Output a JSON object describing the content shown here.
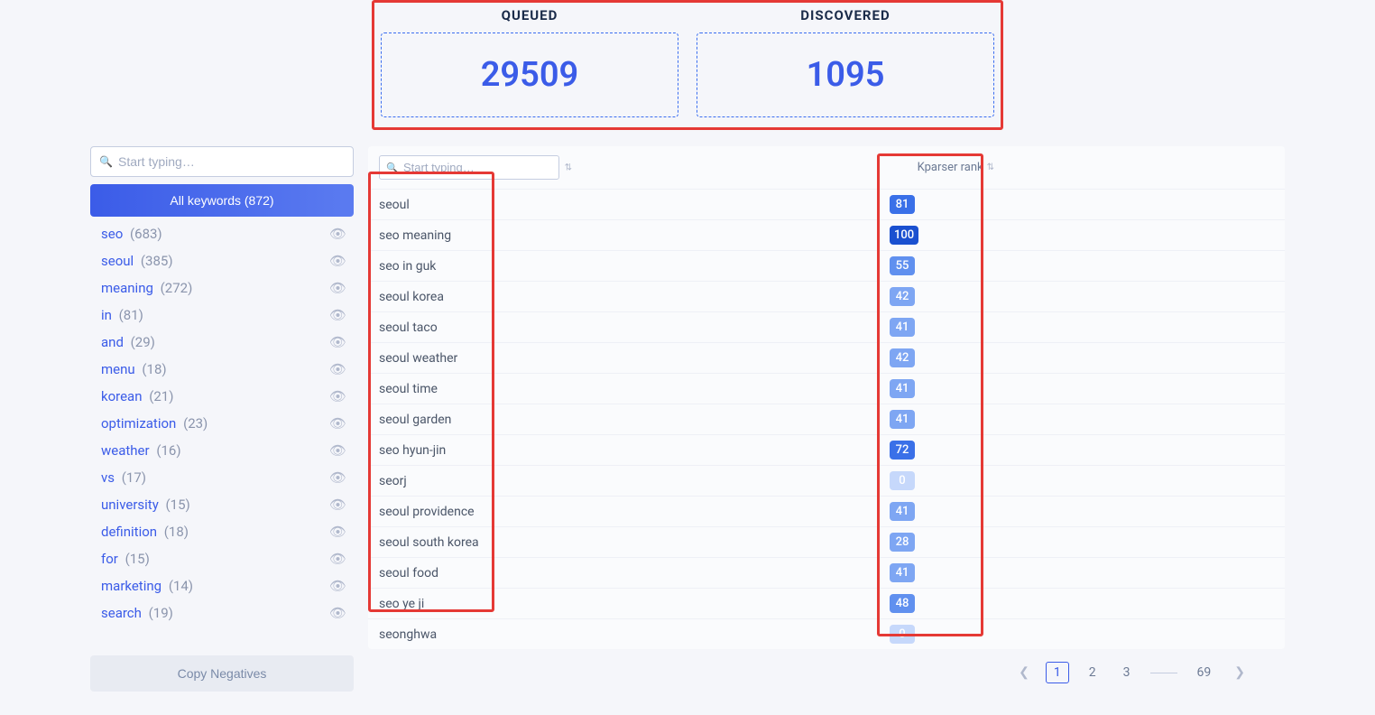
{
  "stats": {
    "queued": {
      "label": "QUEUED",
      "value": "29509"
    },
    "discovered": {
      "label": "DISCOVERED",
      "value": "1095"
    }
  },
  "sidebar": {
    "search_placeholder": "Start typing…",
    "all_keywords_label": "All keywords (872)",
    "copy_negatives_label": "Copy Negatives",
    "items": [
      {
        "label": "seo",
        "count": "(683)"
      },
      {
        "label": "seoul",
        "count": "(385)"
      },
      {
        "label": "meaning",
        "count": "(272)"
      },
      {
        "label": "in",
        "count": "(81)"
      },
      {
        "label": "and",
        "count": "(29)"
      },
      {
        "label": "menu",
        "count": "(18)"
      },
      {
        "label": "korean",
        "count": "(21)"
      },
      {
        "label": "optimization",
        "count": "(23)"
      },
      {
        "label": "weather",
        "count": "(16)"
      },
      {
        "label": "vs",
        "count": "(17)"
      },
      {
        "label": "university",
        "count": "(15)"
      },
      {
        "label": "definition",
        "count": "(18)"
      },
      {
        "label": "for",
        "count": "(15)"
      },
      {
        "label": "marketing",
        "count": "(14)"
      },
      {
        "label": "search",
        "count": "(19)"
      }
    ]
  },
  "table": {
    "search_placeholder": "Start typing…",
    "rank_header": "Kparser rank",
    "rows": [
      {
        "term": "seoul",
        "rank": "81",
        "cls": "rank-high"
      },
      {
        "term": "seo meaning",
        "rank": "100",
        "cls": "rank-top"
      },
      {
        "term": "seo in guk",
        "rank": "55",
        "cls": "rank-mid"
      },
      {
        "term": "seoul korea",
        "rank": "42",
        "cls": "rank-low"
      },
      {
        "term": "seoul taco",
        "rank": "41",
        "cls": "rank-low"
      },
      {
        "term": "seoul weather",
        "rank": "42",
        "cls": "rank-low"
      },
      {
        "term": "seoul time",
        "rank": "41",
        "cls": "rank-low"
      },
      {
        "term": "seoul garden",
        "rank": "41",
        "cls": "rank-low"
      },
      {
        "term": "seo hyun-jin",
        "rank": "72",
        "cls": "rank-high"
      },
      {
        "term": "seorj",
        "rank": "0",
        "cls": "rank-0"
      },
      {
        "term": "seoul providence",
        "rank": "41",
        "cls": "rank-low"
      },
      {
        "term": "seoul south korea",
        "rank": "28",
        "cls": "rank-low"
      },
      {
        "term": "seoul food",
        "rank": "41",
        "cls": "rank-low"
      },
      {
        "term": "seo ye ji",
        "rank": "48",
        "cls": "rank-mid"
      },
      {
        "term": "seonghwa",
        "rank": "0",
        "cls": "rank-0"
      }
    ]
  },
  "pagination": {
    "pages": [
      "1",
      "2",
      "3"
    ],
    "last": "69"
  }
}
